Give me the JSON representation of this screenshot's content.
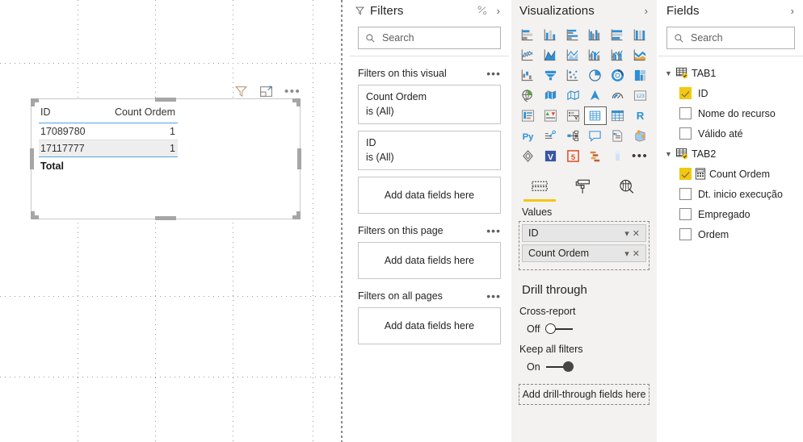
{
  "canvas": {
    "visual_header_icons": [
      "filter-icon",
      "focus-mode-icon",
      "more-options-icon"
    ],
    "table_visual": {
      "columns": [
        "ID",
        "Count Ordem"
      ],
      "rows": [
        {
          "ID": "17089780",
          "Count Ordem": "1"
        },
        {
          "ID": "17117777",
          "Count Ordem": "1"
        }
      ],
      "total_label": "Total",
      "total_value": ""
    }
  },
  "filters": {
    "title": "Filters",
    "search_placeholder": "Search",
    "sections": [
      {
        "label": "Filters on this visual",
        "cards": [
          {
            "field": "Count Ordem",
            "condition": "is (All)"
          },
          {
            "field": "ID",
            "condition": "is (All)"
          }
        ],
        "dropzone": "Add data fields here"
      },
      {
        "label": "Filters on this page",
        "cards": [],
        "dropzone": "Add data fields here"
      },
      {
        "label": "Filters on all pages",
        "cards": [],
        "dropzone": "Add data fields here"
      }
    ]
  },
  "visualizations": {
    "title": "Visualizations",
    "gallery": [
      {
        "name": "stacked-bar-chart-icon",
        "selected": false
      },
      {
        "name": "stacked-column-chart-icon",
        "selected": false
      },
      {
        "name": "clustered-bar-chart-icon",
        "selected": false
      },
      {
        "name": "clustered-column-chart-icon",
        "selected": false
      },
      {
        "name": "hundred-percent-stacked-bar-chart-icon",
        "selected": false
      },
      {
        "name": "hundred-percent-stacked-column-chart-icon",
        "selected": false
      },
      {
        "name": "line-chart-icon",
        "selected": false
      },
      {
        "name": "area-chart-icon",
        "selected": false
      },
      {
        "name": "stacked-area-chart-icon",
        "selected": false
      },
      {
        "name": "line-and-stacked-column-chart-icon",
        "selected": false
      },
      {
        "name": "line-and-clustered-column-chart-icon",
        "selected": false
      },
      {
        "name": "ribbon-chart-icon",
        "selected": false
      },
      {
        "name": "waterfall-chart-icon",
        "selected": false
      },
      {
        "name": "funnel-chart-icon",
        "selected": false
      },
      {
        "name": "scatter-chart-icon",
        "selected": false
      },
      {
        "name": "pie-chart-icon",
        "selected": false
      },
      {
        "name": "donut-chart-icon",
        "selected": false
      },
      {
        "name": "treemap-icon",
        "selected": false
      },
      {
        "name": "map-icon",
        "selected": false
      },
      {
        "name": "filled-map-icon",
        "selected": false
      },
      {
        "name": "shape-map-icon",
        "selected": false
      },
      {
        "name": "arcgis-map-icon",
        "selected": false
      },
      {
        "name": "gauge-icon",
        "selected": false
      },
      {
        "name": "card-icon",
        "selected": false
      },
      {
        "name": "multi-row-card-icon",
        "selected": false
      },
      {
        "name": "kpi-icon",
        "selected": false
      },
      {
        "name": "slicer-icon",
        "selected": false
      },
      {
        "name": "table-icon",
        "selected": true
      },
      {
        "name": "matrix-icon",
        "selected": false
      },
      {
        "name": "r-script-visual-icon",
        "selected": false
      },
      {
        "name": "python-visual-icon",
        "selected": false
      },
      {
        "name": "key-influencers-icon",
        "selected": false
      },
      {
        "name": "decomposition-tree-icon",
        "selected": false
      },
      {
        "name": "qna-icon",
        "selected": false
      },
      {
        "name": "smart-narrative-icon",
        "selected": false
      },
      {
        "name": "paginated-report-icon",
        "selected": false
      },
      {
        "name": "power-apps-icon",
        "selected": false
      },
      {
        "name": "visio-visual-icon",
        "selected": false
      },
      {
        "name": "html-viewer-icon",
        "selected": false
      },
      {
        "name": "gantt-chart-icon",
        "selected": false
      },
      {
        "name": "bullet-chart-icon",
        "selected": false
      },
      {
        "name": "more-visuals-icon",
        "selected": false
      }
    ],
    "tabs": [
      {
        "name": "fields-tab",
        "icon": "fields-icon",
        "active": true
      },
      {
        "name": "format-tab",
        "icon": "paint-roller-icon",
        "active": false
      },
      {
        "name": "analytics-tab",
        "icon": "magnifier-analytics-icon",
        "active": false
      }
    ],
    "values_label": "Values",
    "values_wells": [
      "ID",
      "Count Ordem"
    ],
    "drill_through": {
      "title": "Drill through",
      "cross_report_label": "Cross-report",
      "cross_report_state": "Off",
      "keep_all_filters_label": "Keep all filters",
      "keep_all_filters_state": "On",
      "dropzone": "Add drill-through fields here"
    }
  },
  "fields": {
    "title": "Fields",
    "search_placeholder": "Search",
    "tables": [
      {
        "name": "TAB1",
        "expanded": true,
        "checked": true,
        "fields": [
          {
            "label": "ID",
            "checked": true,
            "measure": false
          },
          {
            "label": "Nome do recurso",
            "checked": false,
            "measure": false
          },
          {
            "label": "Válido até",
            "checked": false,
            "measure": false
          }
        ]
      },
      {
        "name": "TAB2",
        "expanded": true,
        "checked": true,
        "fields": [
          {
            "label": "Count Ordem",
            "checked": true,
            "measure": true
          },
          {
            "label": "Dt. inicio execução",
            "checked": false,
            "measure": false
          },
          {
            "label": "Empregado",
            "checked": false,
            "measure": false
          },
          {
            "label": "Ordem",
            "checked": false,
            "measure": false
          }
        ]
      }
    ]
  },
  "colors": {
    "accent_yellow": "#f2c811",
    "pane_background": "#f3f2f1",
    "table_header_rule": "#4da6e0",
    "alt_row": "#eeeeee"
  }
}
